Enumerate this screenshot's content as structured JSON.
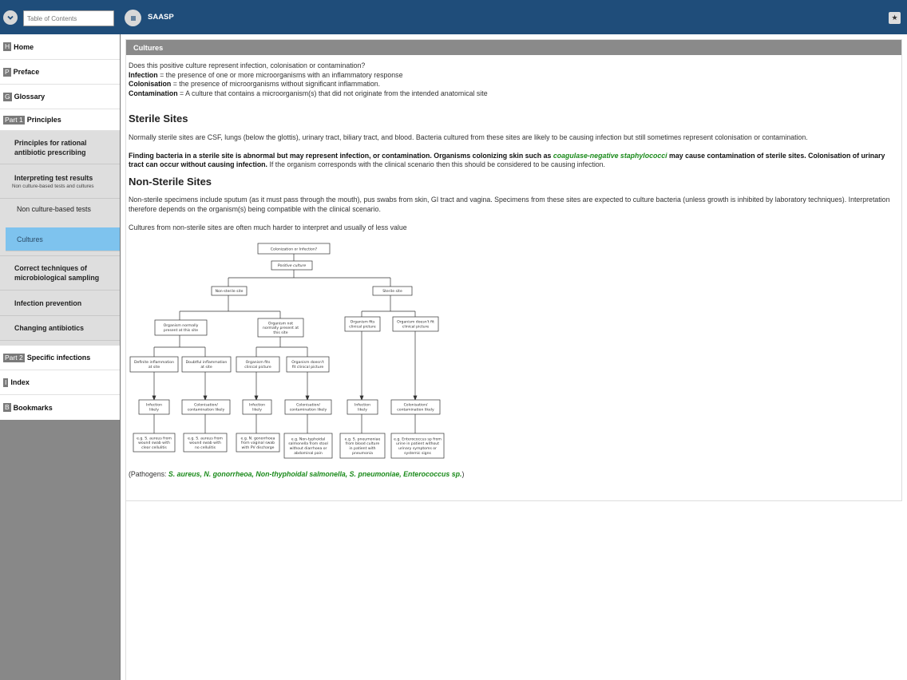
{
  "header": {
    "toc_placeholder": "Table of Contents",
    "app_title": "SAASP"
  },
  "sidebar": {
    "items": [
      {
        "badge": "H",
        "label": "Home"
      },
      {
        "badge": "P",
        "label": "Preface"
      },
      {
        "badge": "G",
        "label": "Glossary"
      },
      {
        "badge": "Part 1",
        "label": "Principles"
      },
      {
        "badge": "Part 2",
        "label": "Specific infections"
      },
      {
        "badge": "I",
        "label": "Index"
      },
      {
        "badge": "B",
        "label": "Bookmarks"
      }
    ],
    "principles_children": {
      "rational": "Principles for rational antibiotic prescribing",
      "interpreting": "Interpreting test results",
      "interpreting_sub": "Non culture-based tests and cultures",
      "non_culture": "Non culture-based tests",
      "cultures": "Cultures",
      "correct": "Correct techniques of microbiological sampling",
      "prevention": "Infection prevention",
      "changing": "Changing antibiotics"
    }
  },
  "content": {
    "section_title": "Cultures",
    "intro_q": "Does this positive culture represent infection, colonisation or contamination?",
    "def_infection_term": "Infection",
    "def_infection_text": " = the presence of one or more microorganisms with an inflammatory response",
    "def_colonisation_term": "Colonisation",
    "def_colonisation_text": " = the presence of microorganisms without significant inflammation.",
    "def_contamination_term": "Contamination",
    "def_contamination_text": " = A culture that contains a microorganism(s) that did not originate from the intended anatomical site",
    "sterile_heading": "Sterile Sites",
    "sterile_p1": "Normally sterile sites are CSF, lungs (below the glottis), urinary tract, biliary tract, and blood. Bacteria cultured from these sites are likely to be causing infection but still sometimes represent colonisation or contamination.",
    "sterile_p2_bold_a": "Finding bacteria in a sterile site is abnormal but may represent infection, or contamination. Organisms colonizing skin such as ",
    "sterile_p2_green": "coagulase-negative staphylococci",
    "sterile_p2_bold_b": " may cause contamination of sterile sites. Colonisation of urinary tract can occur without causing infection.",
    "sterile_p2_rest": " If the organism corresponds with the clinical scenario then this should be considered to be causing infection.",
    "nonsterile_heading": "Non-Sterile Sites",
    "nonsterile_p1": "Non-sterile specimens include sputum (as it must pass through the mouth), pus swabs from skin, GI tract and vagina. Specimens from these sites are expected to culture bacteria (unless growth is inhibited by laboratory techniques). Interpretation therefore depends on the organism(s) being compatible with the clinical scenario.",
    "nonsterile_p2": "Cultures from non-sterile sites are often much harder to interpret and usually of less value",
    "pathogens_prefix": "(Pathogens:  ",
    "pathogens_list": "S. aureus, N. gonorrheoa, Non-thyphoidal salmonella, S. pneumoniae, Enterococcus sp.",
    "pathogens_suffix": ")"
  },
  "flowchart": {
    "root": "Colonization or Infection?",
    "positive": "Positive culture",
    "non_sterile": "Non-sterile site",
    "sterile": "Sterile site",
    "org_normal": [
      "Organism  normally",
      "present at this site"
    ],
    "org_not_normal": [
      "Organism not",
      "normally present at",
      "this site"
    ],
    "fits_clin_s": [
      "Organism fits",
      "clinical picture"
    ],
    "nofit_clin_s": [
      "Organism  doesn't fit",
      "clinical picture"
    ],
    "definite": [
      "Definite inflammation",
      "at site"
    ],
    "doubtful": [
      "Doubtful inflammation",
      "at site"
    ],
    "fits_clin_n": [
      "Organism fits",
      "clinical picture"
    ],
    "nofit_clin_n": [
      "Organism  doesn't",
      "fit clinical picture"
    ],
    "inf1": [
      "Infection",
      "likely"
    ],
    "col1": [
      "Colonisation/",
      "contamination likely"
    ],
    "inf2": [
      "Infection",
      "likely"
    ],
    "col2": [
      "Colonisation/",
      "contamination likely"
    ],
    "inf3": [
      "Infection",
      "likely"
    ],
    "col3": [
      "Colonisation/",
      "contamination likely"
    ],
    "ex1": [
      "e.g. S. aureus from",
      "wound swab with",
      "clear cellulitis"
    ],
    "ex2": [
      "e.g. S. aureus from",
      "wound swab with",
      "no cellulitis"
    ],
    "ex3": [
      "e.g. N. gonorrhoea",
      "from vaginal swab",
      "with PV discharge"
    ],
    "ex4": [
      "e.g. Non-typhoidal",
      "salmonella from stool",
      "without diarrhoea or",
      "abdominal pain"
    ],
    "ex5": [
      "e.g. S. pneumoniae",
      "from blood culture",
      "in patient with",
      "pneumonia"
    ],
    "ex6": [
      "e.g. Enterococcus  sp from",
      "urine in patient without",
      "urinary symptoms or",
      "systemic signs"
    ]
  },
  "colors": {
    "topbar": "#1f4d7a",
    "active_nav": "#7ec3ee",
    "pathogen_green": "#1a8a1a"
  }
}
